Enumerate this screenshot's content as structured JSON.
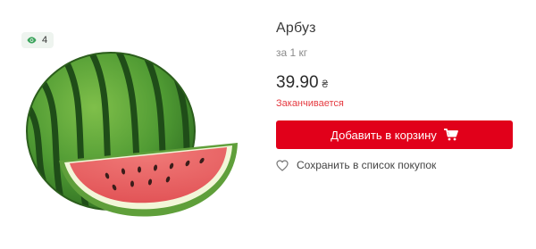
{
  "views": {
    "count": "4"
  },
  "product": {
    "name": "Арбуз",
    "unit": "за 1 кг",
    "price": "39.90",
    "currency": "₴",
    "stock_status": "Заканчивается"
  },
  "actions": {
    "add_to_cart_label": "Добавить в корзину",
    "save_to_list_label": "Сохранить в список покупок"
  },
  "colors": {
    "accent": "#e1001a",
    "stock_warning": "#e53a40"
  },
  "icons": {
    "views": "eye-icon",
    "cart": "cart-icon",
    "wishlist": "heart-icon"
  }
}
